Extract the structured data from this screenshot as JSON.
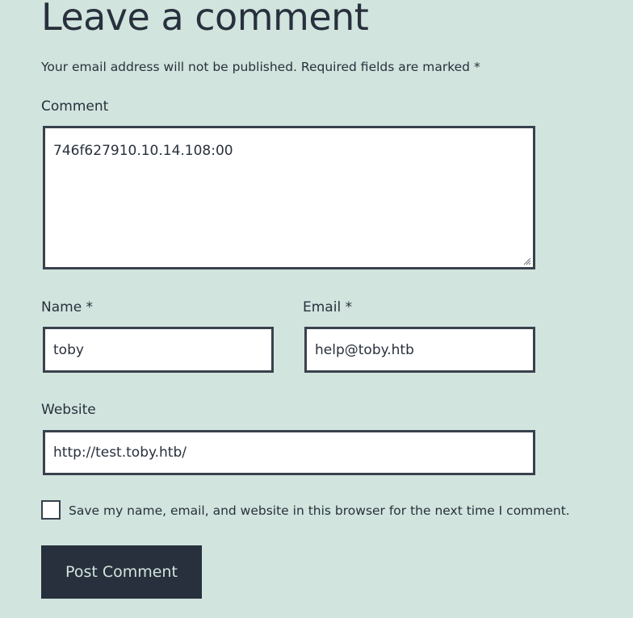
{
  "reply": {
    "title": "Leave a comment",
    "notes": "Your email address will not be published. Required fields are marked *"
  },
  "comment": {
    "label": "Comment",
    "value": "746f627910.10.14.108:00"
  },
  "author": {
    "label": "Name *",
    "value": "toby"
  },
  "email": {
    "label": "Email *",
    "value": "help@toby.htb"
  },
  "website": {
    "label": "Website",
    "value": "http://test.toby.htb/"
  },
  "cookies_consent": {
    "label": "Save my name, email, and website in this browser for the next time I comment.",
    "checked": false
  },
  "submit": {
    "label": "Post Comment"
  },
  "colors": {
    "background": "#d1e4dd",
    "text": "#28303d",
    "button": "#28303d",
    "border": "#39414d"
  }
}
